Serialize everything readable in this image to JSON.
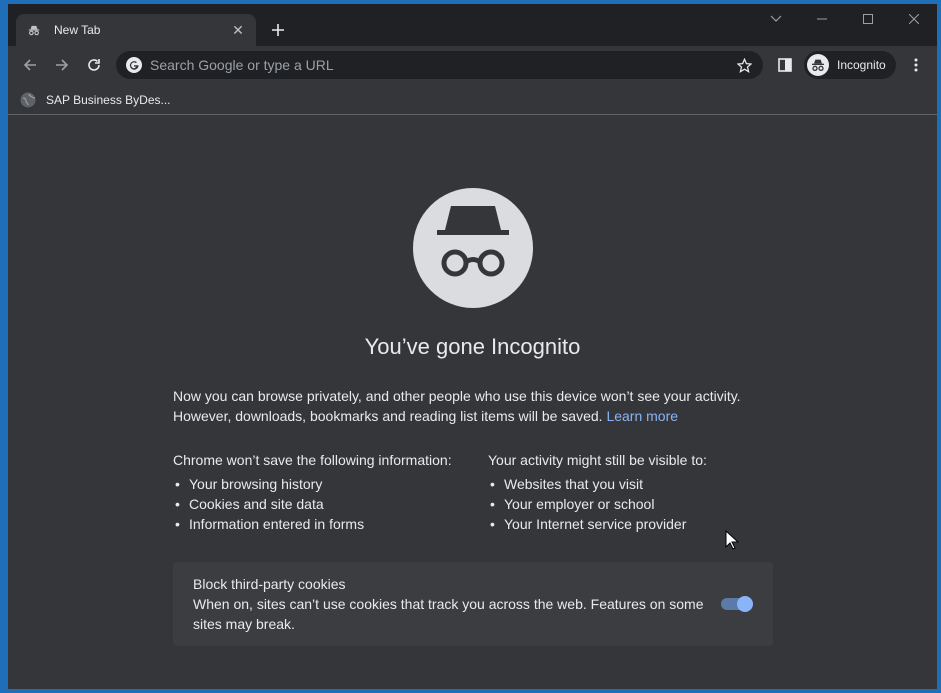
{
  "tab": {
    "title": "New Tab"
  },
  "omnibox": {
    "placeholder": "Search Google or type a URL"
  },
  "profile": {
    "label": "Incognito"
  },
  "bookmarks": [
    {
      "label": "SAP Business ByDes..."
    }
  ],
  "page": {
    "headline": "You’ve gone Incognito",
    "intro_line1": "Now you can browse privately, and other people who use this device won’t see your activity.",
    "intro_line2": "However, downloads, bookmarks and reading list items will be saved.",
    "learn_more": "Learn more",
    "left_col": {
      "heading": "Chrome won’t save the following information:",
      "items": [
        "Your browsing history",
        "Cookies and site data",
        "Information entered in forms"
      ]
    },
    "right_col": {
      "heading": "Your activity might still be visible to:",
      "items": [
        "Websites that you visit",
        "Your employer or school",
        "Your Internet service provider"
      ]
    },
    "cookies": {
      "title": "Block third-party cookies",
      "description": "When on, sites can’t use cookies that track you across the web. Features on some sites may break.",
      "enabled": true
    }
  },
  "colors": {
    "accent": "#8ab4f8",
    "background": "#35363a",
    "tabstrip": "#202124"
  },
  "icons": [
    "incognito-icon",
    "close-icon",
    "plus-icon",
    "back-icon",
    "forward-icon",
    "reload-icon",
    "google-icon",
    "star-icon",
    "side-panel-icon",
    "menu-icon",
    "globe-icon"
  ]
}
